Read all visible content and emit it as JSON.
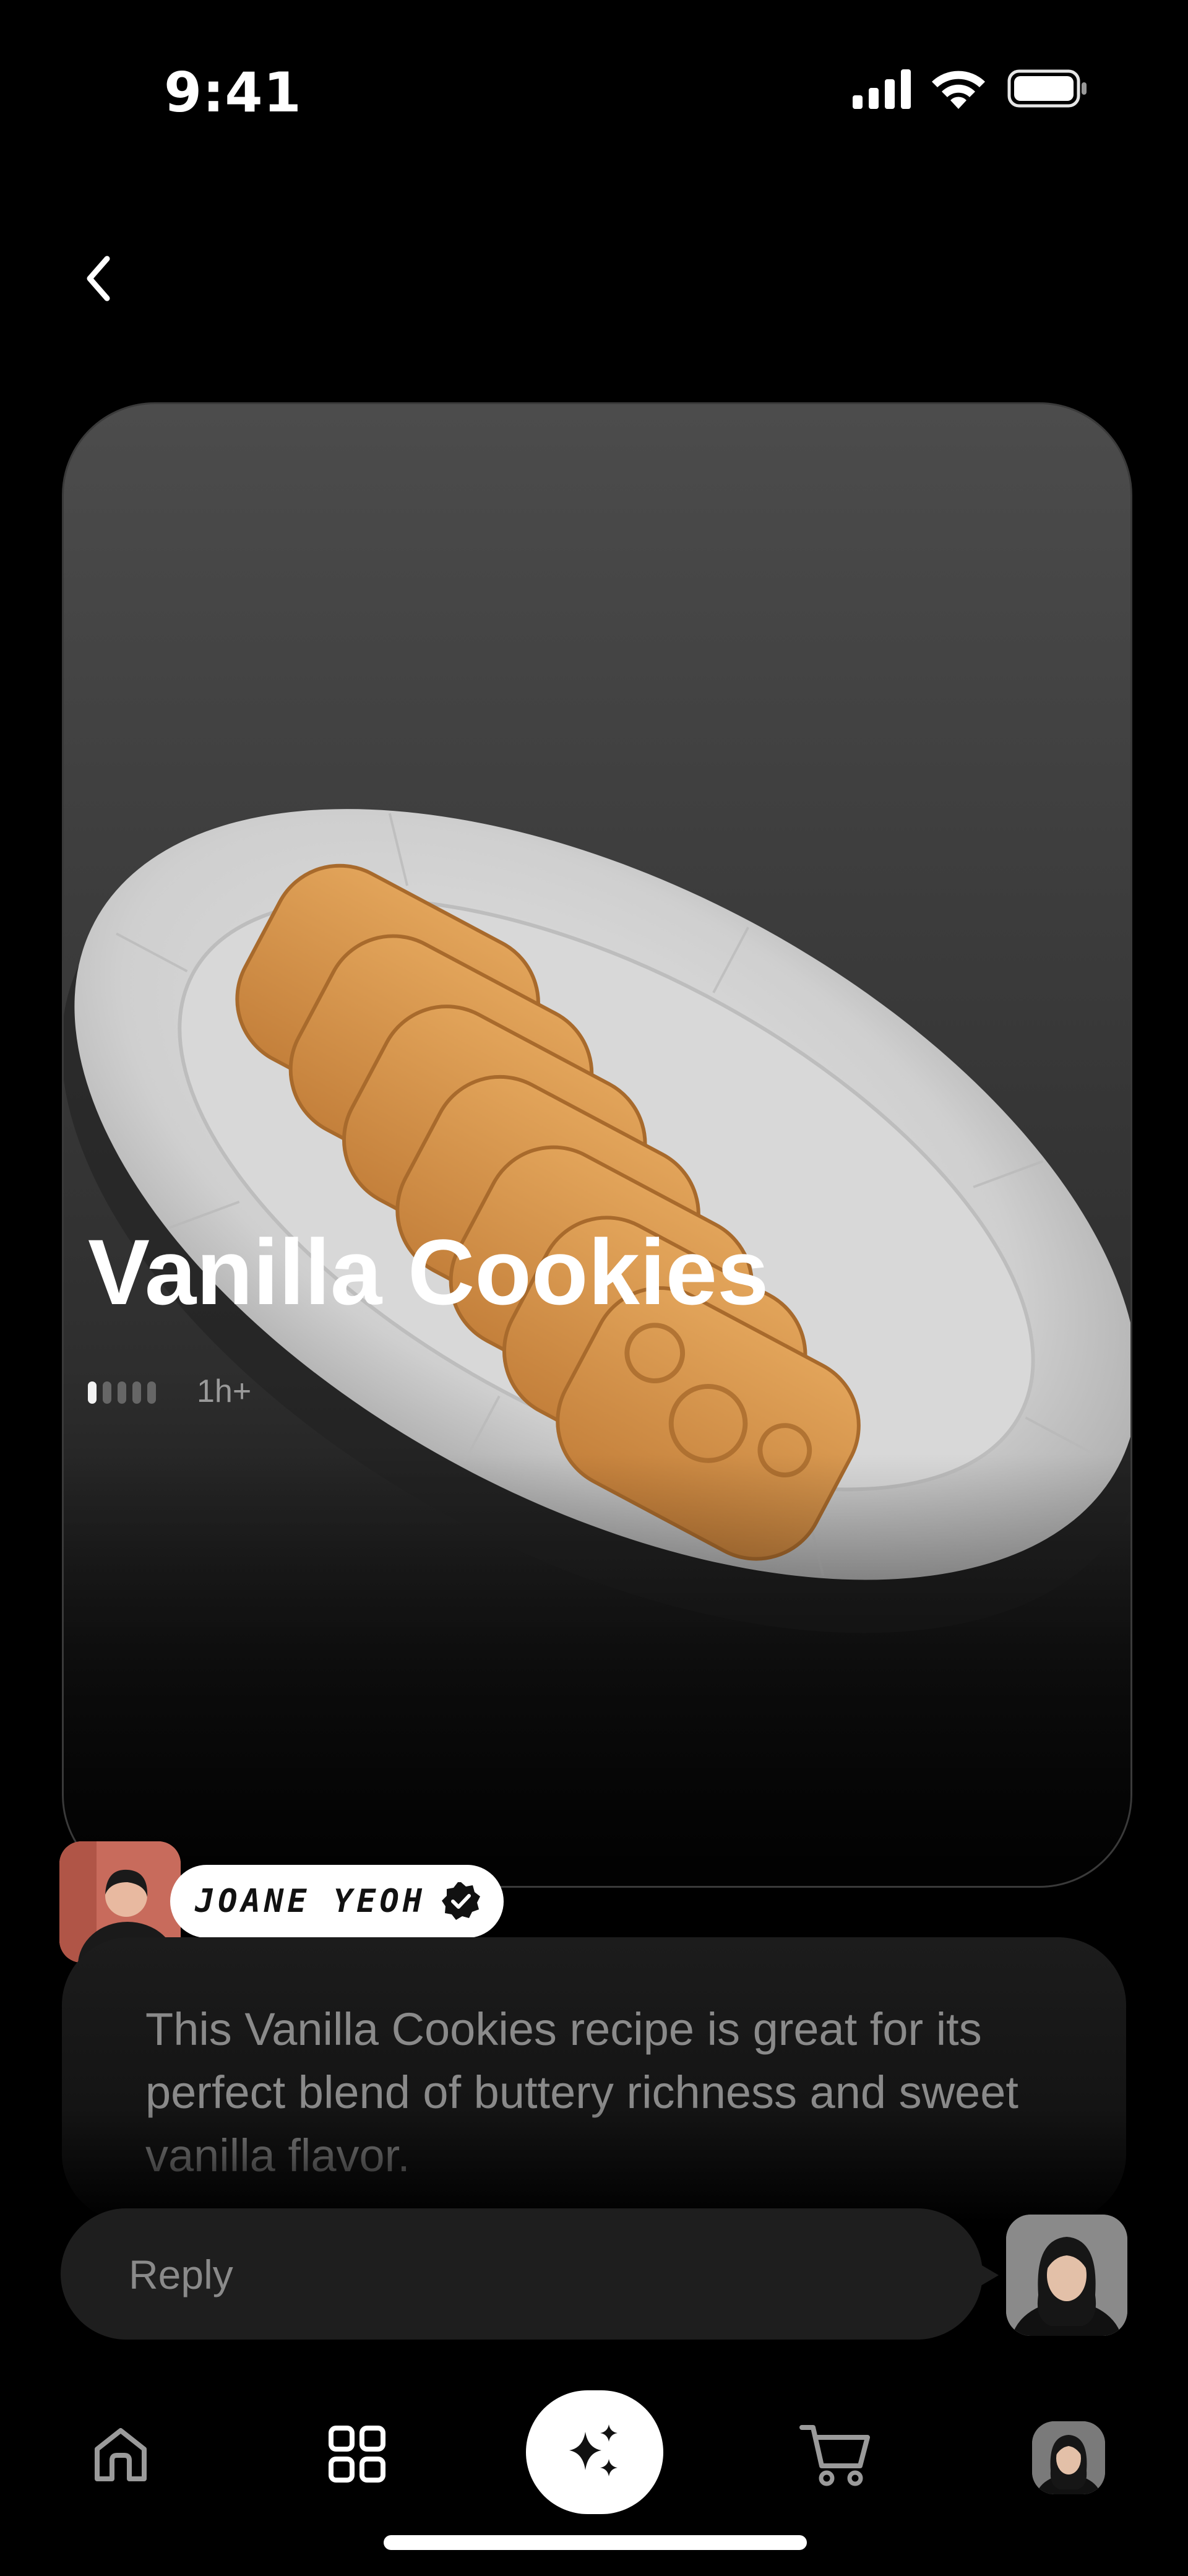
{
  "status_bar": {
    "time": "9:41"
  },
  "recipe": {
    "title": "Vanilla Cookies",
    "difficulty": {
      "level": 1,
      "max": 5
    },
    "duration": "1h+",
    "author": {
      "name": "JOANE YEOH",
      "verified": true
    },
    "description": "This Vanilla Cookies recipe is great for its perfect blend of buttery richness and sweet vanilla flavor."
  },
  "reply": {
    "placeholder": "Reply"
  },
  "tab_bar": {
    "items": [
      {
        "icon": "home-icon"
      },
      {
        "icon": "grid-icon"
      },
      {
        "icon": "sparkle-icon",
        "active": true
      },
      {
        "icon": "cart-icon"
      },
      {
        "icon": "profile-avatar"
      }
    ]
  },
  "colors": {
    "background": "#000000",
    "chip": "#ffffff",
    "input": "#1e1e1e",
    "muted_text": "#8a8a8a"
  }
}
